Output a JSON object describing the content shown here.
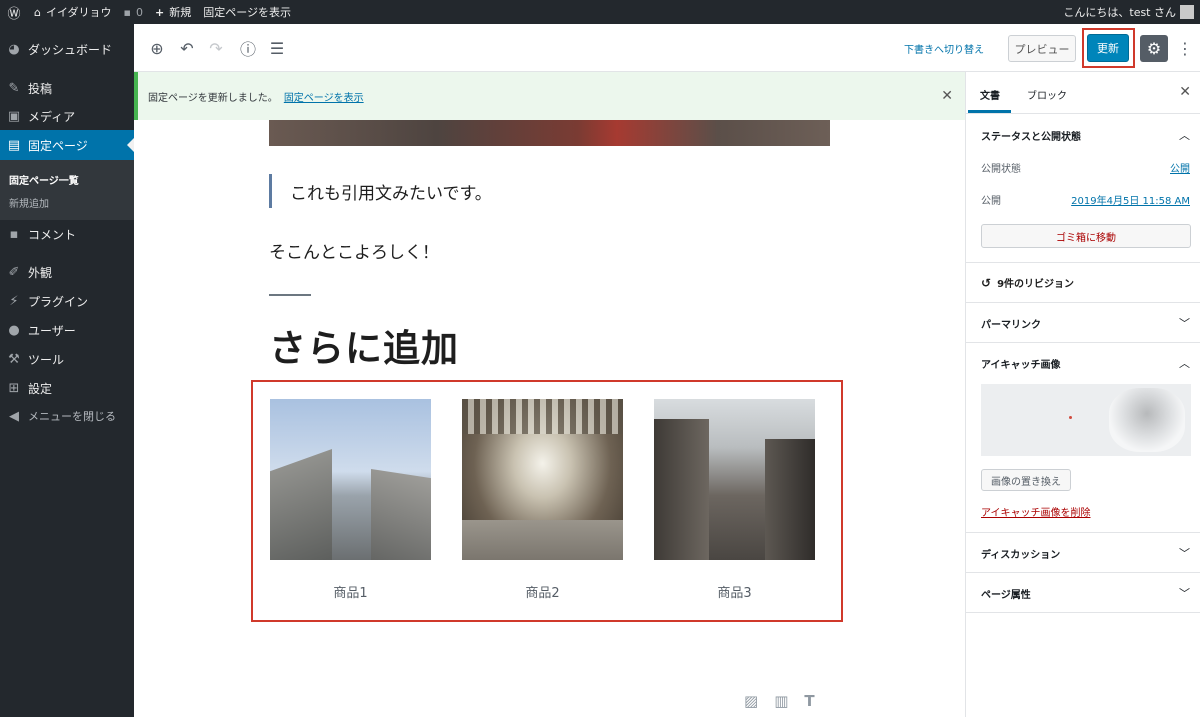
{
  "admin_bar": {
    "site_name": "イイダリョウ",
    "comments_count": "0",
    "new_label": "新規",
    "view_page_label": "固定ページを表示",
    "greeting": "こんにちは、test さん"
  },
  "sidebar": {
    "dashboard": "ダッシュボード",
    "posts": "投稿",
    "media": "メディア",
    "pages": "固定ページ",
    "pages_list": "固定ページ一覧",
    "add_new": "新規追加",
    "comments": "コメント",
    "appearance": "外観",
    "plugins": "プラグイン",
    "users": "ユーザー",
    "tools": "ツール",
    "settings": "設定",
    "collapse": "メニューを閉じる"
  },
  "toolbar": {
    "switch_to_draft": "下書きへ切り替え",
    "preview": "プレビュー",
    "update": "更新"
  },
  "notice": {
    "message": "固定ページを更新しました。",
    "link": "固定ページを表示"
  },
  "content": {
    "quote": "これも引用文みたいです。",
    "paragraph": "そこんとこよろしく！",
    "heading": "さらに追加",
    "gallery": [
      {
        "caption": "商品1"
      },
      {
        "caption": "商品2"
      },
      {
        "caption": "商品3"
      }
    ]
  },
  "settings_panel": {
    "tab_document": "文書",
    "tab_block": "ブロック",
    "status_title": "ステータスと公開状態",
    "visibility_label": "公開状態",
    "visibility_value": "公開",
    "publish_label": "公開",
    "publish_value": "2019年4月5日 11:58 AM",
    "trash": "ゴミ箱に移動",
    "revisions": "9件のリビジョン",
    "permalink": "パーマリンク",
    "featured_image": "アイキャッチ画像",
    "replace_image": "画像の置き換え",
    "remove_image": "アイキャッチ画像を削除",
    "discussion": "ディスカッション",
    "page_attributes": "ページ属性"
  },
  "colors": {
    "admin_dark": "#23282d",
    "accent_blue": "#0073aa",
    "highlight_red": "#d0392b",
    "notice_green": "#46b450"
  }
}
